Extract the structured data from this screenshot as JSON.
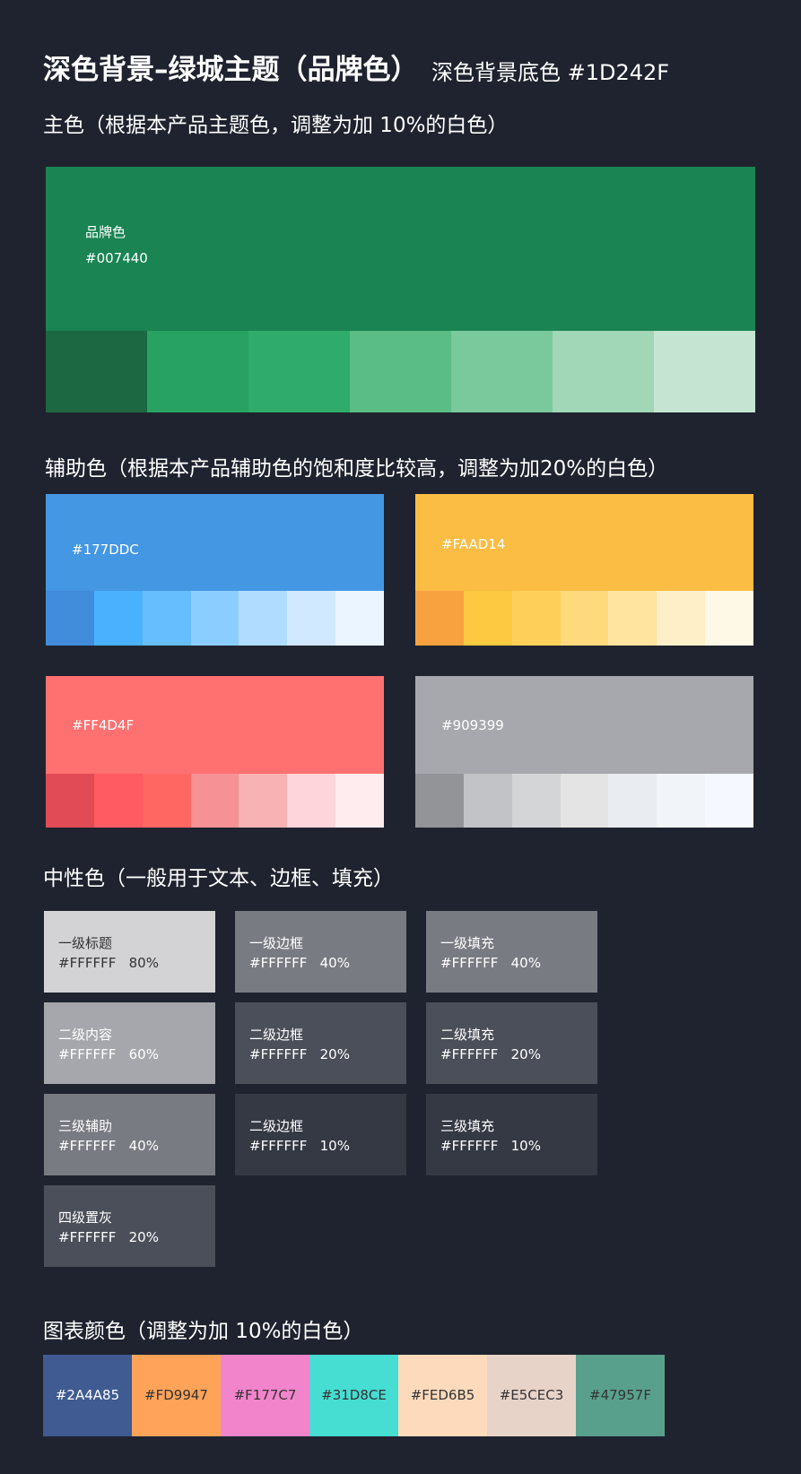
{
  "header": {
    "title": "深色背景–绿城主题（品牌色）",
    "subtitle": "深色背景底色 #1D242F"
  },
  "primary": {
    "title": "主色（根据本产品主题色，调整为加 10%的白色）",
    "brand_label": "品牌色",
    "brand_hex": "#007440",
    "brand_color": "#1A8453",
    "shades": [
      "#1C6843",
      "#28A263",
      "#2FAC6C",
      "#5ABD86",
      "#7AC99C",
      "#A1D6B7",
      "#C5E5D2"
    ]
  },
  "auxiliary": {
    "title": "辅助色（根据本产品辅助色的饱和度比较高，调整为加20%的白色）",
    "blue": {
      "hex": "#177DDC",
      "color": "#4497E3",
      "shades": [
        "#428DDB",
        "#4AB1FF",
        "#67BEFF",
        "#8CCDFF",
        "#B0DCFF",
        "#D0E9FE",
        "#EAF5FF"
      ]
    },
    "yellow": {
      "hex": "#FAAD14",
      "color": "#FBBD43",
      "shades": [
        "#F8A13F",
        "#FDC941",
        "#FED059",
        "#FEDA7D",
        "#FEE49E",
        "#FEEFC9",
        "#FEF8E7"
      ]
    },
    "red": {
      "hex": "#FF4D4F",
      "color": "#FF7171",
      "shades": [
        "#E04B55",
        "#FF5B63",
        "#FF6862",
        "#F69296",
        "#F8B2B4",
        "#FED5DB",
        "#FFECEE"
      ]
    },
    "gray": {
      "hex": "#909399",
      "color": "#A6A8AD",
      "shades": [
        "#929498",
        "#C1C3C6",
        "#D4D5D7",
        "#E4E4E4",
        "#E9ECF0",
        "#F1F4F8",
        "#F5F9FF"
      ]
    }
  },
  "neutral": {
    "title": "中性色（一般用于文本、边框、填充）",
    "items": [
      {
        "name": "一级标题",
        "value": "#FFFFFF   80%",
        "color": "#D3D3D5",
        "text": "#333333"
      },
      {
        "name": "二级内容",
        "value": "#FFFFFF   60%",
        "color": "#A6A7AC",
        "text": "#FFFFFF"
      },
      {
        "name": "三级辅助",
        "value": "#FFFFFF   40%",
        "color": "#797B82",
        "text": "#FFFFFF"
      },
      {
        "name": "四级置灰",
        "value": "#FFFFFF   20%",
        "color": "#4B4F59",
        "text": "#FFFFFF"
      },
      {
        "name": "一级边框",
        "value": "#FFFFFF   40%",
        "color": "#797B82",
        "text": "#FFFFFF"
      },
      {
        "name": "二级边框",
        "value": "#FFFFFF   20%",
        "color": "#4B4F59",
        "text": "#FFFFFF"
      },
      {
        "name": "二级边框",
        "value": "#FFFFFF   10%",
        "color": "#353944",
        "text": "#FFFFFF"
      },
      {
        "name": "一级填充",
        "value": "#FFFFFF   40%",
        "color": "#797B82",
        "text": "#FFFFFF"
      },
      {
        "name": "二级填充",
        "value": "#FFFFFF   20%",
        "color": "#4B4F59",
        "text": "#FFFFFF"
      },
      {
        "name": "三级填充",
        "value": "#FFFFFF   10%",
        "color": "#353944",
        "text": "#FFFFFF"
      }
    ]
  },
  "chart_colors": {
    "title": "图表颜色（调整为加 10%的白色）",
    "items": [
      {
        "hex": "#2A4A85",
        "color": "#3F5B91",
        "text": "#FFFFFF"
      },
      {
        "hex": "#FD9947",
        "color": "#FFA359",
        "text": "#333333"
      },
      {
        "hex": "#F177C7",
        "color": "#F284CC",
        "text": "#333333"
      },
      {
        "hex": "#31D8CE",
        "color": "#46DDD3",
        "text": "#333333"
      },
      {
        "hex": "#FED6B5",
        "color": "#FEDABC",
        "text": "#333333"
      },
      {
        "hex": "#E5CEC3",
        "color": "#E8D3C9",
        "text": "#333333"
      },
      {
        "hex": "#47957F",
        "color": "#59A08C",
        "text": "#333333"
      }
    ]
  }
}
